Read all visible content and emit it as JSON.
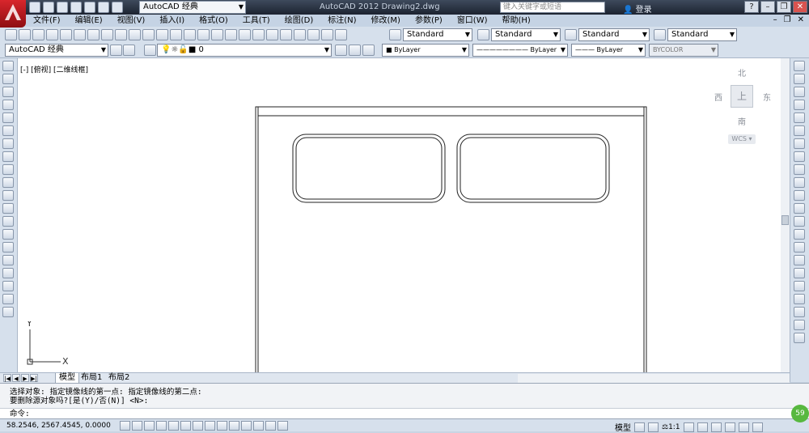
{
  "window": {
    "workspace": "AutoCAD 经典",
    "title": "AutoCAD 2012    Drawing2.dwg",
    "search_placeholder": "键入关键字或短语",
    "login": "登录"
  },
  "menu": [
    "文件(F)",
    "编辑(E)",
    "视图(V)",
    "插入(I)",
    "格式(O)",
    "工具(T)",
    "绘图(D)",
    "标注(N)",
    "修改(M)",
    "参数(P)",
    "窗口(W)",
    "帮助(H)"
  ],
  "styles": {
    "text_style": "Standard",
    "dim_style": "Standard",
    "table_style": "Standard",
    "multileader_style": "Standard"
  },
  "properties": {
    "workspace_combo": "AutoCAD 经典",
    "layer": "0",
    "color": "ByLayer",
    "linetype": "ByLayer",
    "lineweight": "ByLayer",
    "plotstyle": "BYCOLOR"
  },
  "viewport": {
    "label": "[-] [俯视] [二维线框]",
    "compass_n": "北",
    "compass_s": "南",
    "compass_e": "东",
    "compass_w": "西",
    "cube_face": "上",
    "wcs": "WCS ▾"
  },
  "ucs": {
    "x": "X",
    "y": "Y"
  },
  "tabs": [
    "模型",
    "布局1",
    "布局2"
  ],
  "command": {
    "line1": "选择对象:  指定镜像线的第一点: 指定镜像线的第二点:",
    "line2": "要删除源对象吗?[是(Y)/否(N)] <N>:",
    "prompt": "命令:"
  },
  "status": {
    "coords": "58.2546,  2567.4545, 0.0000",
    "model": "模型",
    "scale": "1:1",
    "badge": "59"
  }
}
